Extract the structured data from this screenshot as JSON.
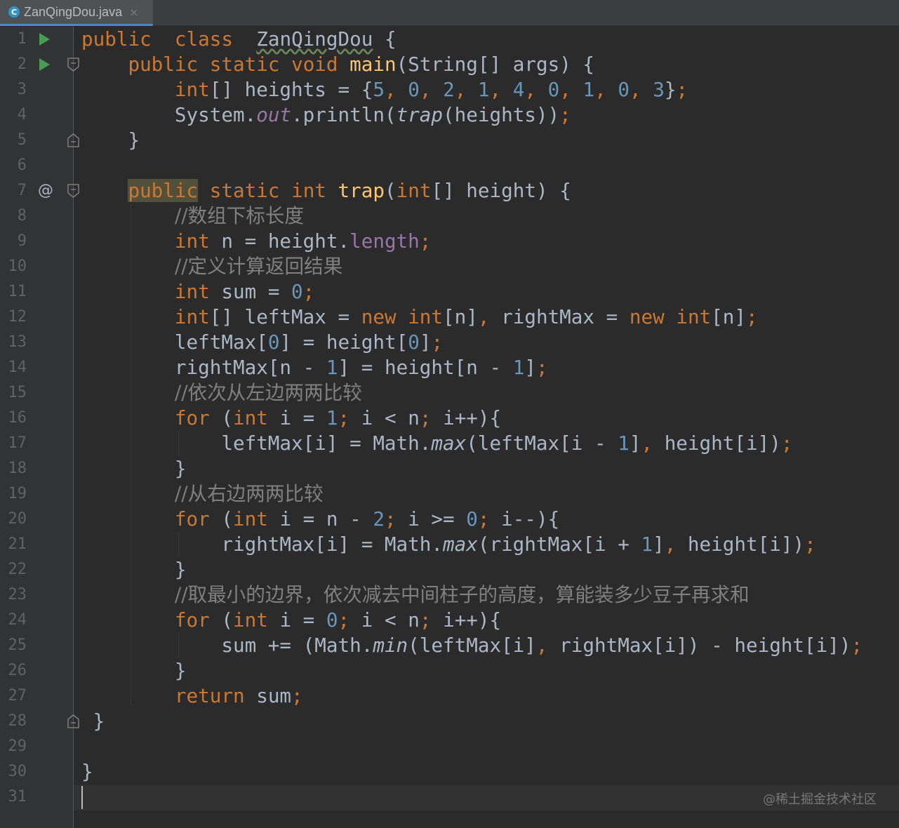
{
  "tab": {
    "icon": "c-class-icon",
    "icon_letter": "C",
    "filename": "ZanQingDou.java",
    "close": "×"
  },
  "gutter": {
    "line_numbers": [
      "1",
      "2",
      "3",
      "4",
      "5",
      "6",
      "7",
      "8",
      "9",
      "10",
      "11",
      "12",
      "13",
      "14",
      "15",
      "16",
      "17",
      "18",
      "19",
      "20",
      "21",
      "22",
      "23",
      "24",
      "25",
      "26",
      "27",
      "28",
      "29",
      "30",
      "31"
    ],
    "override_marker": "@"
  },
  "code": [
    {
      "line": 1,
      "tokens": [
        [
          "kw",
          "public"
        ],
        [
          "",
          "  "
        ],
        [
          "kw",
          "class"
        ],
        [
          "",
          "  "
        ],
        [
          "wavy",
          "ZanQingDou"
        ],
        [
          "",
          " {"
        ]
      ]
    },
    {
      "line": 2,
      "tokens": [
        [
          "",
          "    "
        ],
        [
          "kw",
          "public"
        ],
        [
          "",
          " "
        ],
        [
          "kw",
          "static"
        ],
        [
          "",
          " "
        ],
        [
          "kw",
          "void"
        ],
        [
          "",
          " "
        ],
        [
          "fn",
          "main"
        ],
        [
          "",
          "(String[] args) {"
        ]
      ]
    },
    {
      "line": 3,
      "tokens": [
        [
          "",
          "        "
        ],
        [
          "kw",
          "int"
        ],
        [
          "",
          "[] heights = {"
        ],
        [
          "num",
          "5"
        ],
        [
          "kw",
          ", "
        ],
        [
          "num",
          "0"
        ],
        [
          "kw",
          ", "
        ],
        [
          "num",
          "2"
        ],
        [
          "kw",
          ", "
        ],
        [
          "num",
          "1"
        ],
        [
          "kw",
          ", "
        ],
        [
          "num",
          "4"
        ],
        [
          "kw",
          ", "
        ],
        [
          "num",
          "0"
        ],
        [
          "kw",
          ", "
        ],
        [
          "num",
          "1"
        ],
        [
          "kw",
          ", "
        ],
        [
          "num",
          "0"
        ],
        [
          "kw",
          ", "
        ],
        [
          "num",
          "3"
        ],
        [
          "",
          "}"
        ],
        [
          "kw",
          ";"
        ]
      ]
    },
    {
      "line": 4,
      "tokens": [
        [
          "",
          "        System."
        ],
        [
          "fld it",
          "out"
        ],
        [
          "",
          ".println("
        ],
        [
          "it",
          "trap"
        ],
        [
          "",
          "(heights))"
        ],
        [
          "kw",
          ";"
        ]
      ]
    },
    {
      "line": 5,
      "tokens": [
        [
          "",
          "    }"
        ]
      ]
    },
    {
      "line": 6,
      "tokens": []
    },
    {
      "line": 7,
      "tokens": [
        [
          "",
          "    "
        ],
        [
          "kw hl",
          "public"
        ],
        [
          "",
          " "
        ],
        [
          "kw",
          "static"
        ],
        [
          "",
          " "
        ],
        [
          "kw",
          "int"
        ],
        [
          "",
          " "
        ],
        [
          "fn",
          "trap"
        ],
        [
          "",
          "("
        ],
        [
          "kw",
          "int"
        ],
        [
          "",
          "[] height) {"
        ]
      ]
    },
    {
      "line": 8,
      "tokens": [
        [
          "",
          "        "
        ],
        [
          "cm",
          "//数组下标长度"
        ]
      ]
    },
    {
      "line": 9,
      "tokens": [
        [
          "",
          "        "
        ],
        [
          "kw",
          "int"
        ],
        [
          "",
          " n = height."
        ],
        [
          "fld",
          "length"
        ],
        [
          "kw",
          ";"
        ]
      ]
    },
    {
      "line": 10,
      "tokens": [
        [
          "",
          "        "
        ],
        [
          "cm",
          "//定义计算返回结果"
        ]
      ]
    },
    {
      "line": 11,
      "tokens": [
        [
          "",
          "        "
        ],
        [
          "kw",
          "int"
        ],
        [
          "",
          " sum = "
        ],
        [
          "num",
          "0"
        ],
        [
          "kw",
          ";"
        ]
      ]
    },
    {
      "line": 12,
      "tokens": [
        [
          "",
          "        "
        ],
        [
          "kw",
          "int"
        ],
        [
          "",
          "[] leftMax = "
        ],
        [
          "kw",
          "new"
        ],
        [
          "",
          " "
        ],
        [
          "kw",
          "int"
        ],
        [
          "",
          "[n]"
        ],
        [
          "kw",
          ","
        ],
        [
          "",
          " rightMax = "
        ],
        [
          "kw",
          "new"
        ],
        [
          "",
          " "
        ],
        [
          "kw",
          "int"
        ],
        [
          "",
          "[n]"
        ],
        [
          "kw",
          ";"
        ]
      ]
    },
    {
      "line": 13,
      "tokens": [
        [
          "",
          "        leftMax["
        ],
        [
          "num",
          "0"
        ],
        [
          "",
          "] = height["
        ],
        [
          "num",
          "0"
        ],
        [
          "",
          "]"
        ],
        [
          "kw",
          ";"
        ]
      ]
    },
    {
      "line": 14,
      "tokens": [
        [
          "",
          "        rightMax[n - "
        ],
        [
          "num",
          "1"
        ],
        [
          "",
          "] = height[n - "
        ],
        [
          "num",
          "1"
        ],
        [
          "",
          "]"
        ],
        [
          "kw",
          ";"
        ]
      ]
    },
    {
      "line": 15,
      "tokens": [
        [
          "",
          "        "
        ],
        [
          "cm",
          "//依次从左边两两比较"
        ]
      ]
    },
    {
      "line": 16,
      "tokens": [
        [
          "",
          "        "
        ],
        [
          "kw",
          "for"
        ],
        [
          "",
          " ("
        ],
        [
          "kw",
          "int"
        ],
        [
          "",
          " i = "
        ],
        [
          "num",
          "1"
        ],
        [
          "kw",
          ";"
        ],
        [
          "",
          " i < n"
        ],
        [
          "kw",
          ";"
        ],
        [
          "",
          " i++){"
        ]
      ]
    },
    {
      "line": 17,
      "tokens": [
        [
          "",
          "            leftMax[i] = Math."
        ],
        [
          "it",
          "max"
        ],
        [
          "",
          "(leftMax[i - "
        ],
        [
          "num",
          "1"
        ],
        [
          "",
          "]"
        ],
        [
          "kw",
          ","
        ],
        [
          "",
          " height[i])"
        ],
        [
          "kw",
          ";"
        ]
      ]
    },
    {
      "line": 18,
      "tokens": [
        [
          "",
          "        }"
        ]
      ]
    },
    {
      "line": 19,
      "tokens": [
        [
          "",
          "        "
        ],
        [
          "cm",
          "//从右边两两比较"
        ]
      ]
    },
    {
      "line": 20,
      "tokens": [
        [
          "",
          "        "
        ],
        [
          "kw",
          "for"
        ],
        [
          "",
          " ("
        ],
        [
          "kw",
          "int"
        ],
        [
          "",
          " i = n - "
        ],
        [
          "num",
          "2"
        ],
        [
          "kw",
          ";"
        ],
        [
          "",
          " i >= "
        ],
        [
          "num",
          "0"
        ],
        [
          "kw",
          ";"
        ],
        [
          "",
          " i--){"
        ]
      ]
    },
    {
      "line": 21,
      "tokens": [
        [
          "",
          "            rightMax[i] = Math."
        ],
        [
          "it",
          "max"
        ],
        [
          "",
          "(rightMax[i + "
        ],
        [
          "num",
          "1"
        ],
        [
          "",
          "]"
        ],
        [
          "kw",
          ","
        ],
        [
          "",
          " height[i])"
        ],
        [
          "kw",
          ";"
        ]
      ]
    },
    {
      "line": 22,
      "tokens": [
        [
          "",
          "        }"
        ]
      ]
    },
    {
      "line": 23,
      "tokens": [
        [
          "",
          "        "
        ],
        [
          "cm",
          "//取最小的边界，依次减去中间柱子的高度，算能装多少豆子再求和"
        ]
      ]
    },
    {
      "line": 24,
      "tokens": [
        [
          "",
          "        "
        ],
        [
          "kw",
          "for"
        ],
        [
          "",
          " ("
        ],
        [
          "kw",
          "int"
        ],
        [
          "",
          " i = "
        ],
        [
          "num",
          "0"
        ],
        [
          "kw",
          ";"
        ],
        [
          "",
          " i < n"
        ],
        [
          "kw",
          ";"
        ],
        [
          "",
          " i++){"
        ]
      ]
    },
    {
      "line": 25,
      "tokens": [
        [
          "",
          "            sum += (Math."
        ],
        [
          "it",
          "min"
        ],
        [
          "",
          "(leftMax[i]"
        ],
        [
          "kw",
          ","
        ],
        [
          "",
          " rightMax[i]) - height[i])"
        ],
        [
          "kw",
          ";"
        ]
      ]
    },
    {
      "line": 26,
      "tokens": [
        [
          "",
          "        }"
        ]
      ]
    },
    {
      "line": 27,
      "tokens": [
        [
          "",
          "        "
        ],
        [
          "kw",
          "return"
        ],
        [
          "",
          " sum"
        ],
        [
          "kw",
          ";"
        ]
      ]
    },
    {
      "line": 28,
      "tokens": [
        [
          "",
          " }"
        ]
      ]
    },
    {
      "line": 29,
      "tokens": []
    },
    {
      "line": 30,
      "tokens": [
        [
          "",
          "}"
        ]
      ]
    },
    {
      "line": 31,
      "tokens": []
    }
  ],
  "watermark": "@稀土掘金技术社区",
  "colors": {
    "background": "#2b2b2b",
    "gutter": "#313335",
    "keyword": "#cc7832",
    "number": "#6897bb",
    "method": "#ffc66d",
    "field": "#9876aa",
    "comment": "#808080",
    "text": "#a9b7c6",
    "run_icon": "#499c54"
  }
}
